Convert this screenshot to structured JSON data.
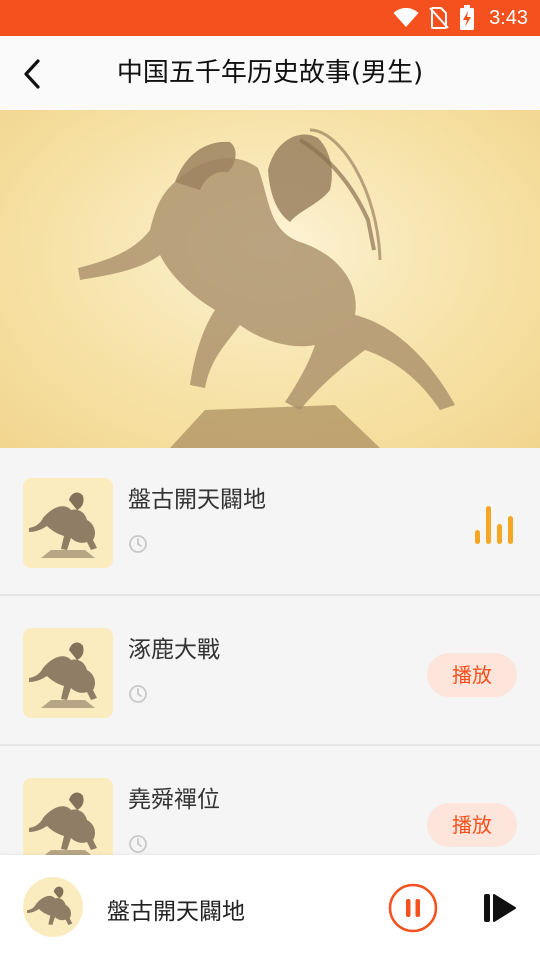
{
  "status_bar": {
    "time": "3:43",
    "icons": [
      "wifi-icon",
      "no-sim-icon",
      "battery-charging-icon"
    ],
    "color": "#f4511e"
  },
  "header": {
    "title": "中国五千年历史故事(男生)",
    "back_icon": "chevron-left-icon"
  },
  "banner": {
    "image": "horseman-statue"
  },
  "episodes": [
    {
      "title": "盤古開天闢地",
      "state": "playing",
      "action_label": ""
    },
    {
      "title": "涿鹿大戰",
      "state": "idle",
      "action_label": "播放"
    },
    {
      "title": "堯舜禪位",
      "state": "idle",
      "action_label": "播放"
    }
  ],
  "player": {
    "title": "盤古開天闢地",
    "pause_icon": "pause-circle-icon",
    "next_icon": "skip-next-icon"
  },
  "colors": {
    "accent": "#f4511e",
    "playing_bars": "#f5a623",
    "play_button_bg": "#fde5dc"
  }
}
